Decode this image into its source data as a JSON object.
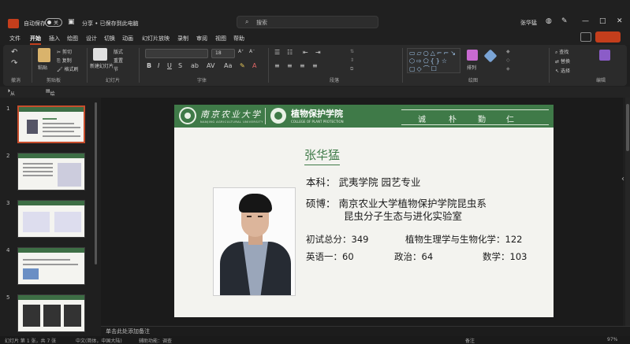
{
  "titlebar": {
    "autosave_label": "自动保存",
    "autosave_state": "关",
    "save_icon": "save-icon",
    "doc_status": "分享 • 已保存到此电脑",
    "search_placeholder": "搜索",
    "user": "张华猛",
    "window_controls": [
      "—",
      "□",
      "✕"
    ]
  },
  "menu": {
    "items": [
      "文件",
      "开始",
      "插入",
      "绘图",
      "设计",
      "切换",
      "动画",
      "幻灯片放映",
      "录制",
      "审阅",
      "视图",
      "帮助"
    ],
    "active": "开始"
  },
  "ribbon": {
    "groups": [
      "撤消",
      "剪贴板",
      "幻灯片",
      "字体",
      "段落",
      "绘图",
      "编辑"
    ],
    "paste": "粘贴",
    "cut": "剪切",
    "copy": "复制",
    "format_painter": "格式刷",
    "new_slide": "新建幻灯片",
    "layout": "版式",
    "reset": "重置",
    "section": "节",
    "font_size": "18",
    "arrange": "排列",
    "find": "查找",
    "replace": "替换",
    "select": "选择"
  },
  "quickbar": {
    "from_start": "从头开始",
    "draw_text": "绘制横排文本框"
  },
  "thumbnails": {
    "numbers": [
      "1",
      "2",
      "3",
      "4",
      "5"
    ],
    "active": 1
  },
  "slide": {
    "university_cn": "南京农业大学",
    "university_en": "NANJING AGRICULTURAL UNIVERSITY",
    "college_cn": "植物保护学院",
    "college_en": "COLLEGE OF PLANT PROTECTION",
    "motto": [
      "诚",
      "朴",
      "勤",
      "仁"
    ],
    "name": "张华猛",
    "undergrad": "本科：  武夷学院 园艺专业",
    "master_line1": "硕博：  南京农业大学植物保护学院昆虫系",
    "master_line2": "昆虫分子生态与进化实验室",
    "prelim_total": "初试总分：349",
    "physio_biochem": "植物生理学与生物化学：122",
    "english": "英语一：60",
    "politics": "政治：64",
    "math": "数学：103"
  },
  "notes": {
    "placeholder": "单击此处添加备注"
  },
  "status": {
    "slide_count": "幻灯片 第 1 张，共 7 张",
    "language": "中文(简体，中国大陆)",
    "accessibility": "辅助功能：调查",
    "notes_btn": "备注",
    "zoom": "97%"
  }
}
